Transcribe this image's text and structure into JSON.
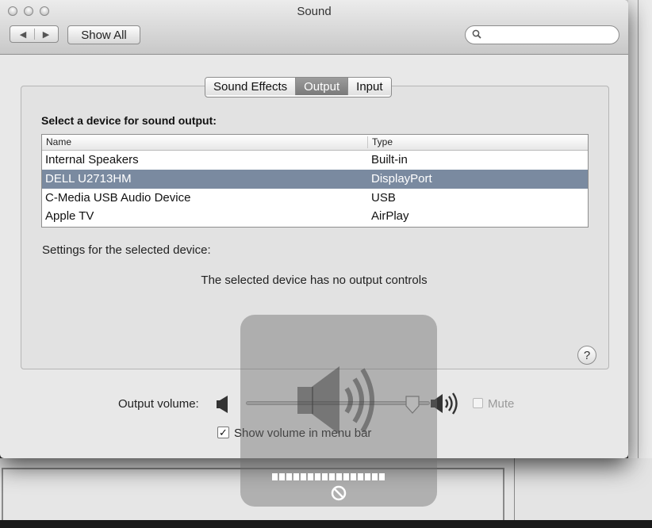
{
  "window": {
    "title": "Sound"
  },
  "toolbar": {
    "back_label": "◀",
    "forward_label": "▶",
    "show_all_label": "Show All",
    "search_placeholder": ""
  },
  "tabs": [
    {
      "label": "Sound Effects",
      "active": false
    },
    {
      "label": "Output",
      "active": true
    },
    {
      "label": "Input",
      "active": false
    }
  ],
  "output": {
    "section_title": "Select a device for sound output:",
    "columns": [
      "Name",
      "Type"
    ],
    "devices": [
      {
        "name": "Internal Speakers",
        "type": "Built-in",
        "selected": false
      },
      {
        "name": "DELL U2713HM",
        "type": "DisplayPort",
        "selected": true
      },
      {
        "name": "C-Media USB Audio Device",
        "type": "USB",
        "selected": false
      },
      {
        "name": "Apple TV",
        "type": "AirPlay",
        "selected": false
      }
    ],
    "settings_label": "Settings for the selected device:",
    "no_controls_text": "The selected device has no output controls",
    "help_label": "?"
  },
  "volume": {
    "label": "Output volume:",
    "level": 0.9,
    "mute_label": "Mute",
    "mute_checked": false,
    "mute_enabled": false,
    "show_in_menu_bar_label": "Show volume in menu bar",
    "show_in_menu_bar_checked": true
  },
  "hud": {
    "volume_segments": 16,
    "icon": "no-entry-icon"
  },
  "colors": {
    "selection": "#7a8aa0",
    "active_tab": "#8a8a8a"
  }
}
